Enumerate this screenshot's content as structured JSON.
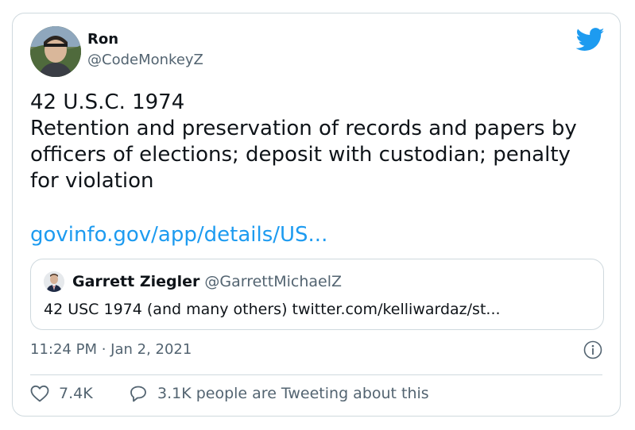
{
  "author": {
    "name": "Ron",
    "handle": "@CodeMonkeyZ"
  },
  "tweet": {
    "lines": [
      "42 U.S.C. 1974",
      "Retention and preservation of records and papers by",
      "officers of elections; deposit with custodian; penalty",
      "for violation"
    ],
    "link": "govinfo.gov/app/details/US..."
  },
  "quoted": {
    "name": "Garrett Ziegler",
    "handle": "@GarrettMichaelZ",
    "text": "42 USC 1974 (and many others) twitter.com/kelliwardaz/st..."
  },
  "meta": {
    "timestamp": "11:24 PM · Jan 2, 2021"
  },
  "actions": {
    "likes": "7.4K",
    "conversation": "3.1K people are Tweeting about this"
  },
  "icons": {
    "brand": "twitter-bird-icon",
    "info": "info-icon",
    "like": "heart-icon",
    "reply": "speech-bubble-icon"
  },
  "colors": {
    "brand": "#1d9bf0",
    "text": "#0f1419",
    "secondary": "#536471",
    "border": "#cfd9de"
  }
}
